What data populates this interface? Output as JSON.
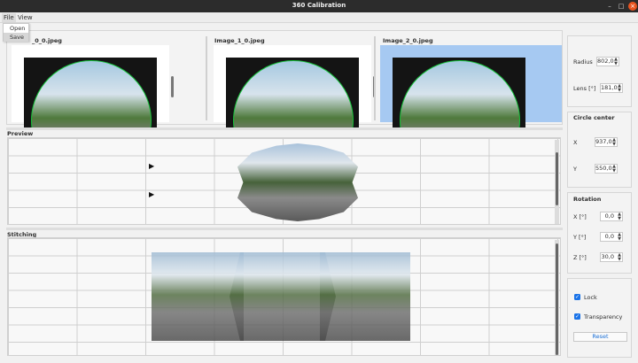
{
  "window": {
    "title": "360 Calibration"
  },
  "menubar": {
    "file": "File",
    "view": "View"
  },
  "file_menu": {
    "open": "Open",
    "save": "Save"
  },
  "thumbnails": [
    {
      "label": "_0_0.jpeg"
    },
    {
      "label": "Image_1_0.jpeg"
    },
    {
      "label": "Image_2_0.jpeg"
    }
  ],
  "sections": {
    "preview": "Preview",
    "stitching": "Stitching"
  },
  "lens_params": {
    "radius_label": "Radius",
    "radius_value": "802,0",
    "lens_label": "Lens [°]",
    "lens_value": "181,0"
  },
  "circle_center": {
    "title": "Circle center",
    "x_label": "X",
    "x_value": "937,0",
    "y_label": "Y",
    "y_value": "550,0"
  },
  "rotation": {
    "title": "Rotation",
    "x_label": "X [°]",
    "x_value": "0,0",
    "y_label": "Y [°]",
    "y_value": "0,0",
    "z_label": "Z [°]",
    "z_value": "30,0"
  },
  "options": {
    "lock_label": "Lock",
    "lock_checked": true,
    "transparency_label": "Transparency",
    "transparency_checked": true,
    "reset_label": "Reset"
  },
  "colors": {
    "titlebar": "#2c2c2c",
    "close_button": "#e95420",
    "selection": "#a6c9f2",
    "circle": "#17c23a",
    "accent": "#1a73e8"
  }
}
